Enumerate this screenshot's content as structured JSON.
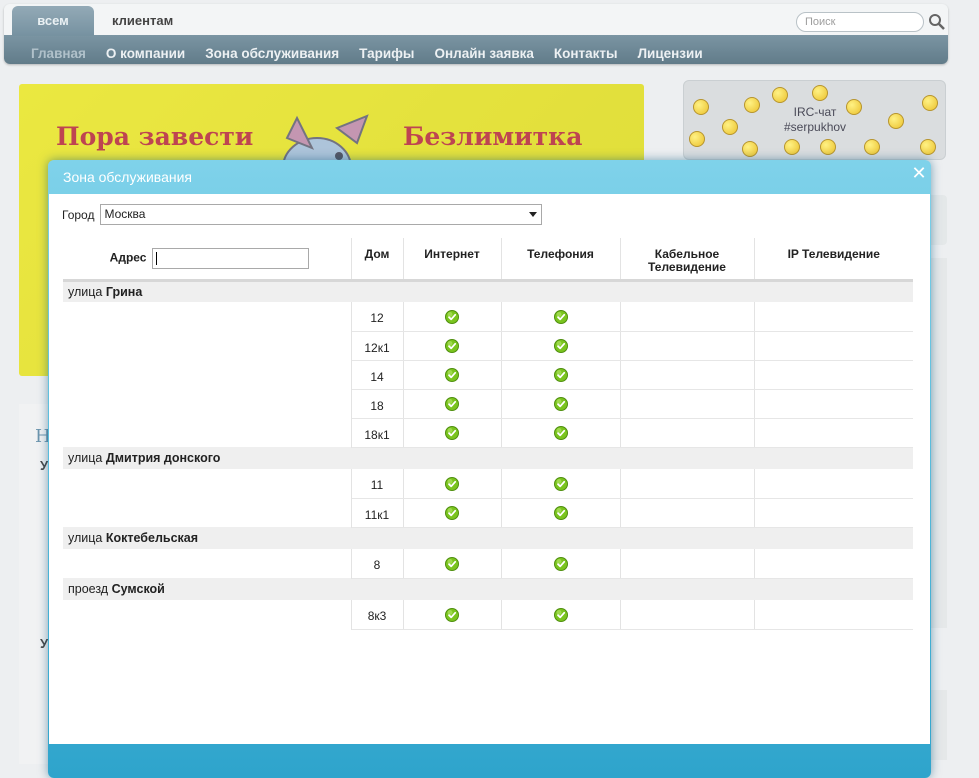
{
  "header": {
    "tab_all": "всем",
    "tab_clients": "клиентам",
    "search_placeholder": "Поиск"
  },
  "nav": {
    "items": [
      "Главная",
      "О компании",
      "Зона обслуживания",
      "Тарифы",
      "Онлайн заявка",
      "Контакты",
      "Лицензии"
    ]
  },
  "banner": {
    "left_text": "Пора завести",
    "right_text": "Безлимитка"
  },
  "irc": {
    "line1": "IRC-чат",
    "line2": "#serpukhov"
  },
  "news": {
    "heading": "Н",
    "u1": "У",
    "u2": "У"
  },
  "modal": {
    "title": "Зона обслуживания",
    "city_label": "Город",
    "city_value": "Москва",
    "columns": {
      "address": "Адрес",
      "house": "Дом",
      "internet": "Интернет",
      "phone": "Телефония",
      "cable_tv_1": "Кабельное",
      "cable_tv_2": "Телевидение",
      "ip_tv": "IP Телевидение"
    },
    "streets": [
      {
        "prefix": "улица",
        "name": "Грина",
        "houses": [
          {
            "num": "12",
            "internet": true,
            "phone": true
          },
          {
            "num": "12к1",
            "internet": true,
            "phone": true
          },
          {
            "num": "14",
            "internet": true,
            "phone": true
          },
          {
            "num": "18",
            "internet": true,
            "phone": true
          },
          {
            "num": "18к1",
            "internet": true,
            "phone": true
          }
        ]
      },
      {
        "prefix": "улица",
        "name": "Дмитрия донского",
        "houses": [
          {
            "num": "11",
            "internet": true,
            "phone": true
          },
          {
            "num": "11к1",
            "internet": true,
            "phone": true
          }
        ]
      },
      {
        "prefix": "улица",
        "name": "Коктебельская",
        "houses": [
          {
            "num": "8",
            "internet": true,
            "phone": true
          }
        ]
      },
      {
        "prefix": "проезд",
        "name": "Сумской",
        "houses": [
          {
            "num": "8к3",
            "internet": true,
            "phone": true
          }
        ]
      }
    ]
  },
  "colors": {
    "nav_bar": "#4a6b7c",
    "modal_header": "#4fbde0",
    "street_row": "#efefef",
    "check": "#7ac41e"
  }
}
